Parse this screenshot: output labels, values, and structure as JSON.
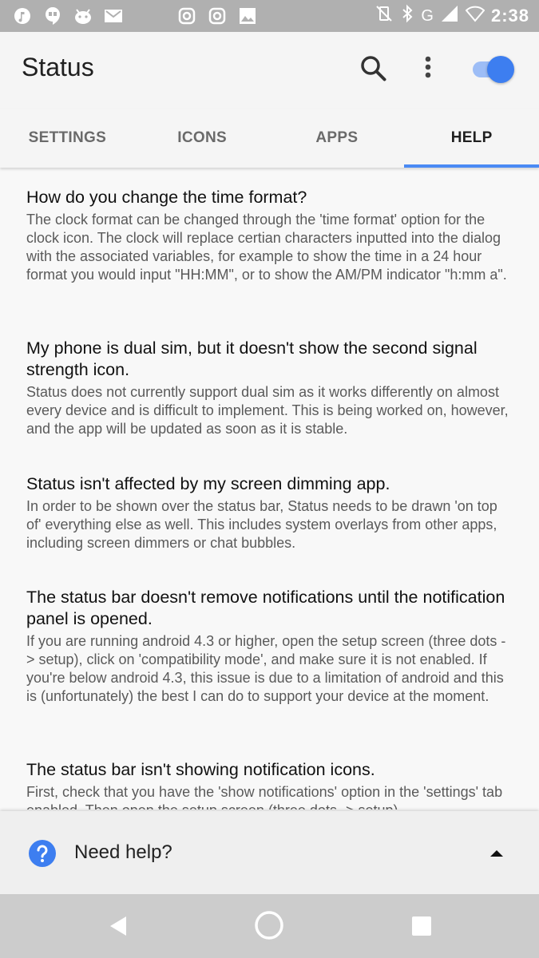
{
  "status_bar": {
    "network": "G",
    "time": "2:38",
    "icons": [
      "music-icon",
      "hangouts-icon",
      "android-icon",
      "gmail-icon",
      "instagram-icon",
      "instagram-icon",
      "image-icon",
      "vibrate-off-icon",
      "bluetooth-icon",
      "signal-icon",
      "wifi-off-icon",
      "battery-icon"
    ]
  },
  "app_bar": {
    "title": "Status",
    "toggle_on": true,
    "accent": "#3d7ef0"
  },
  "tabs": [
    {
      "label": "SETTINGS",
      "active": false
    },
    {
      "label": "ICONS",
      "active": false
    },
    {
      "label": "APPS",
      "active": false
    },
    {
      "label": "HELP",
      "active": true
    }
  ],
  "faqs": [
    {
      "question": "How do you change the time format?",
      "answer": "The clock format can be changed through the 'time format' option for the clock icon. The clock will replace certian characters inputted into the dialog with the associated variables, for example to show the time in a 24 hour format you would input \"HH:MM\", or to show the AM/PM indicator \"h:mm a\"."
    },
    {
      "question": "My phone is dual sim, but it doesn't show the second signal strength icon.",
      "answer": "Status does not currently support dual sim as it works differently on almost every device and is difficult to implement. This is being worked on, however, and the app will be updated as soon as it is stable."
    },
    {
      "question": "Status isn't affected by my screen dimming app.",
      "answer": "In order to be shown over the status bar, Status needs to be drawn 'on top of' everything else as well. This includes system overlays from other apps, including screen dimmers or chat bubbles."
    },
    {
      "question": "The status bar doesn't remove notifications until the notification panel is opened.",
      "answer": "If you are running android 4.3 or higher, open the setup screen (three dots -> setup), click on 'compatibility mode', and make sure it is not enabled. If you're below android 4.3, this issue is due to a limitation of android and this is (unfortunately) the best I can do to support your device at the moment."
    },
    {
      "question": "The status bar isn't showing notification icons.",
      "answer": "First, check that you have the 'show notifications' option in the 'settings' tab enabled. Then open the setup screen (three dots -> setup)..."
    }
  ],
  "help_bar": {
    "label": "Need help?"
  }
}
